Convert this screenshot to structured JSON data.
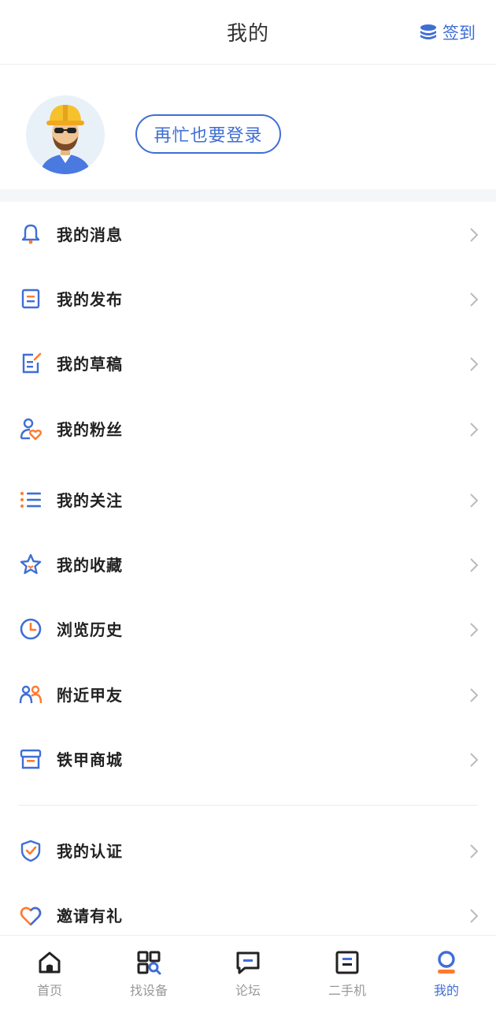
{
  "header": {
    "title": "我的",
    "checkin_label": "签到",
    "checkin_icon": "coins-stack-icon"
  },
  "profile": {
    "avatar_icon": "worker-avatar-icon",
    "login_label": "再忙也要登录"
  },
  "colors": {
    "accent": "#3f6ed6",
    "orange": "#ff7a2f",
    "text": "#222222",
    "muted": "#999999"
  },
  "menu": [
    {
      "label": "我的消息",
      "icon": "bell-icon"
    },
    {
      "label": "我的发布",
      "icon": "document-icon"
    },
    {
      "label": "我的草稿",
      "icon": "edit-note-icon"
    },
    {
      "label": "我的粉丝",
      "icon": "person-heart-icon"
    },
    {
      "label": "我的关注",
      "icon": "list-icon"
    },
    {
      "label": "我的收藏",
      "icon": "star-icon"
    },
    {
      "label": "浏览历史",
      "icon": "clock-icon"
    },
    {
      "label": "附近甲友",
      "icon": "people-icon"
    },
    {
      "label": "铁甲商城",
      "icon": "store-icon"
    }
  ],
  "menu2": [
    {
      "label": "我的认证",
      "icon": "shield-check-icon"
    },
    {
      "label": "邀请有礼",
      "icon": "heart-icon"
    }
  ],
  "tabs": [
    {
      "label": "首页",
      "icon": "home-icon"
    },
    {
      "label": "找设备",
      "icon": "grid-search-icon"
    },
    {
      "label": "论坛",
      "icon": "chat-icon"
    },
    {
      "label": "二手机",
      "icon": "machine-icon"
    },
    {
      "label": "我的",
      "icon": "user-icon",
      "active": true
    }
  ]
}
